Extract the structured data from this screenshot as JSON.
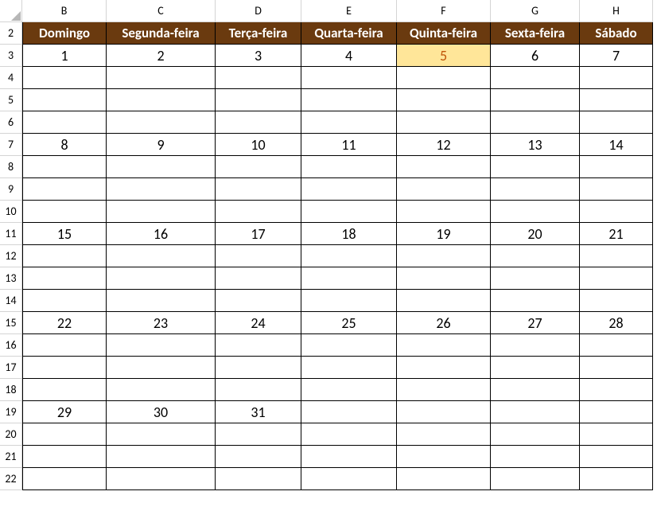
{
  "columns": [
    "B",
    "C",
    "D",
    "E",
    "F",
    "G",
    "H"
  ],
  "row_start": 2,
  "row_count": 21,
  "day_headers": [
    "Domingo",
    "Segunda-feira",
    "Terça-feira",
    "Quarta-feira",
    "Quinta-feira",
    "Sexta-feira",
    "Sábado"
  ],
  "highlight": {
    "row": 3,
    "col": "F"
  },
  "chart_data": {
    "type": "table",
    "title": "Calendar (Portuguese)",
    "columns": [
      "Domingo",
      "Segunda-feira",
      "Terça-feira",
      "Quarta-feira",
      "Quinta-feira",
      "Sexta-feira",
      "Sábado"
    ],
    "rows": [
      [
        1,
        2,
        3,
        4,
        5,
        6,
        7
      ],
      [
        null,
        null,
        null,
        null,
        null,
        null,
        null
      ],
      [
        null,
        null,
        null,
        null,
        null,
        null,
        null
      ],
      [
        null,
        null,
        null,
        null,
        null,
        null,
        null
      ],
      [
        8,
        9,
        10,
        11,
        12,
        13,
        14
      ],
      [
        null,
        null,
        null,
        null,
        null,
        null,
        null
      ],
      [
        null,
        null,
        null,
        null,
        null,
        null,
        null
      ],
      [
        null,
        null,
        null,
        null,
        null,
        null,
        null
      ],
      [
        15,
        16,
        17,
        18,
        19,
        20,
        21
      ],
      [
        null,
        null,
        null,
        null,
        null,
        null,
        null
      ],
      [
        null,
        null,
        null,
        null,
        null,
        null,
        null
      ],
      [
        null,
        null,
        null,
        null,
        null,
        null,
        null
      ],
      [
        22,
        23,
        24,
        25,
        26,
        27,
        28
      ],
      [
        null,
        null,
        null,
        null,
        null,
        null,
        null
      ],
      [
        null,
        null,
        null,
        null,
        null,
        null,
        null
      ],
      [
        null,
        null,
        null,
        null,
        null,
        null,
        null
      ],
      [
        29,
        30,
        31,
        null,
        null,
        null,
        null
      ],
      [
        null,
        null,
        null,
        null,
        null,
        null,
        null
      ],
      [
        null,
        null,
        null,
        null,
        null,
        null,
        null
      ],
      [
        null,
        null,
        null,
        null,
        null,
        null,
        null
      ]
    ]
  }
}
